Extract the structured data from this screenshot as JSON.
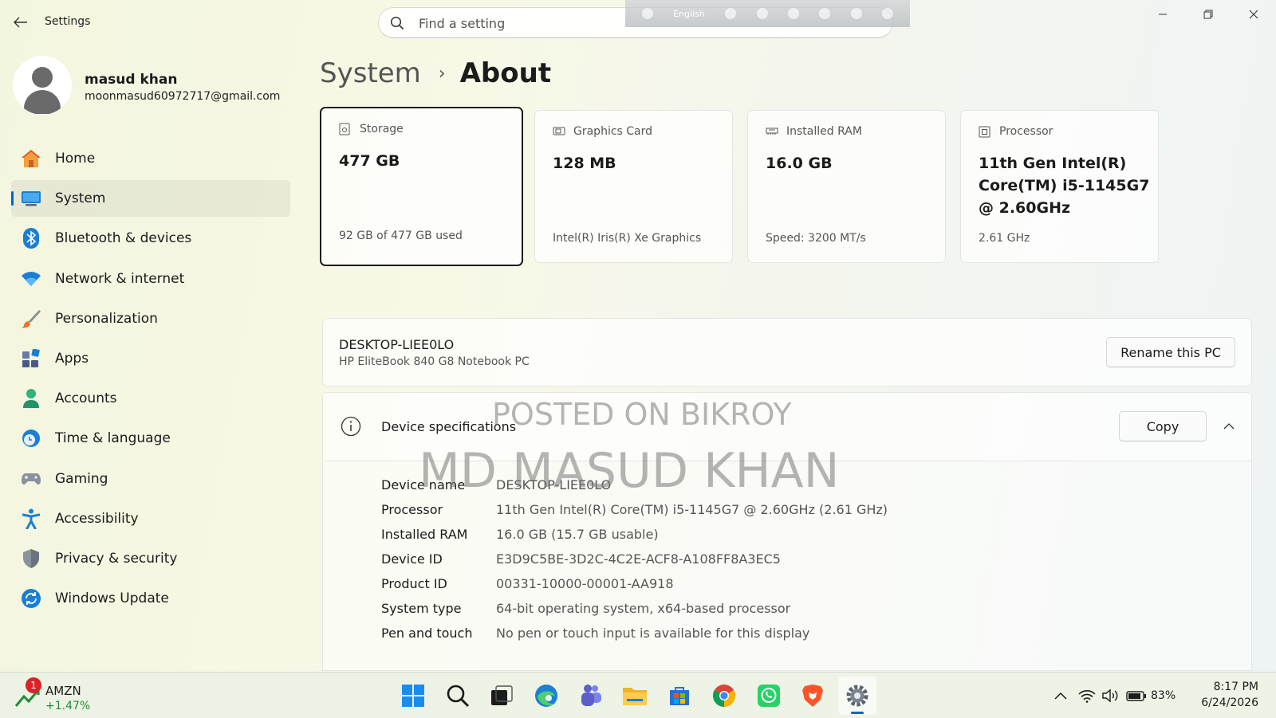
{
  "window": {
    "title": "Settings",
    "search_placeholder": "Find a setting",
    "ime_language": "English"
  },
  "profile": {
    "name": "masud khan",
    "email": "moonmasud60972717@gmail.com"
  },
  "nav": {
    "items": [
      {
        "label": "Home",
        "icon": "home-icon"
      },
      {
        "label": "System",
        "icon": "system-icon",
        "active": true
      },
      {
        "label": "Bluetooth & devices",
        "icon": "bluetooth-icon"
      },
      {
        "label": "Network & internet",
        "icon": "network-icon"
      },
      {
        "label": "Personalization",
        "icon": "brush-icon"
      },
      {
        "label": "Apps",
        "icon": "apps-icon"
      },
      {
        "label": "Accounts",
        "icon": "accounts-icon"
      },
      {
        "label": "Time & language",
        "icon": "time-language-icon"
      },
      {
        "label": "Gaming",
        "icon": "gaming-icon"
      },
      {
        "label": "Accessibility",
        "icon": "accessibility-icon"
      },
      {
        "label": "Privacy & security",
        "icon": "shield-icon"
      },
      {
        "label": "Windows Update",
        "icon": "update-icon"
      }
    ]
  },
  "breadcrumb": {
    "parent": "System",
    "separator": "›",
    "current": "About"
  },
  "cards": [
    {
      "title": "Storage",
      "value": "477 GB",
      "sub": "92 GB of 477 GB used",
      "icon": "storage-icon"
    },
    {
      "title": "Graphics Card",
      "value": "128 MB",
      "sub": "Intel(R) Iris(R) Xe Graphics",
      "icon": "graphics-card-icon"
    },
    {
      "title": "Installed RAM",
      "value": "16.0 GB",
      "sub": "Speed: 3200 MT/s",
      "icon": "ram-icon"
    },
    {
      "title": "Processor",
      "value": "11th Gen Intel(R) Core(TM) i5-1145G7 @ 2.60GHz",
      "sub": "2.61 GHz",
      "icon": "processor-icon"
    }
  ],
  "pc": {
    "name": "DESKTOP-LIEE0LO",
    "model": "HP EliteBook 840 G8 Notebook PC",
    "rename_label": "Rename this PC"
  },
  "specs": {
    "title": "Device specifications",
    "copy_label": "Copy",
    "rows": [
      {
        "label": "Device name",
        "value": "DESKTOP-LIEE0LO"
      },
      {
        "label": "Processor",
        "value": "11th Gen Intel(R) Core(TM) i5-1145G7 @ 2.60GHz (2.61 GHz)"
      },
      {
        "label": "Installed RAM",
        "value": "16.0 GB (15.7 GB usable)"
      },
      {
        "label": "Device ID",
        "value": "E3D9C5BE-3D2C-4C2E-ACF8-A108FF8A3EC5"
      },
      {
        "label": "Product ID",
        "value": "00331-10000-00001-AA918"
      },
      {
        "label": "System type",
        "value": "64-bit operating system, x64-based processor"
      },
      {
        "label": "Pen and touch",
        "value": "No pen or touch input is available for this display"
      }
    ]
  },
  "watermark": {
    "line1": "POSTED ON BIKROY",
    "line2": "MD MASUD KHAN"
  },
  "taskbar": {
    "widget": {
      "badge": "1",
      "ticker": "AMZN",
      "change": "+1.47%"
    },
    "apps": [
      {
        "name": "start-icon"
      },
      {
        "name": "search-icon"
      },
      {
        "name": "task-view-icon"
      },
      {
        "name": "edge-icon"
      },
      {
        "name": "teams-icon"
      },
      {
        "name": "file-explorer-icon"
      },
      {
        "name": "store-icon"
      },
      {
        "name": "chrome-icon"
      },
      {
        "name": "whatsapp-icon"
      },
      {
        "name": "brave-icon"
      },
      {
        "name": "settings-icon",
        "active": true
      }
    ],
    "battery": "83%",
    "time": "8:17 PM",
    "date": "6/24/2026"
  },
  "colors": {
    "accent": "#0067c0",
    "positive": "#1e8c3a",
    "badge": "#d9222a"
  }
}
